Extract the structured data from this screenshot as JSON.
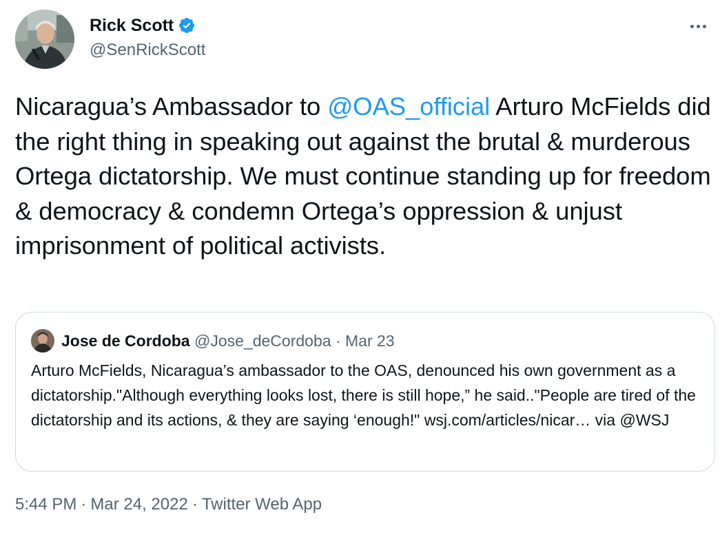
{
  "author": {
    "display_name": "Rick Scott",
    "handle": "@SenRickScott",
    "verified": true,
    "avatar_icon": "profile-photo"
  },
  "more_icon": "more-horizontal-icon",
  "tweet": {
    "text_part1": "Nicaragua’s Ambassador to ",
    "mention": "@OAS_official",
    "text_part2": " Arturo McFields did the right thing in speaking out against the brutal & murderous Ortega dictatorship. We must continue standing up for freedom & democracy & condemn Ortega’s oppression & unjust imprisonment of political activists."
  },
  "quoted_tweet": {
    "display_name": "Jose de Cordoba",
    "handle": "@Jose_deCordoba",
    "separator": "·",
    "date": "Mar 23",
    "text": "Arturo McFields, Nicaragua’s ambassador to the OAS, denounced his own government as a dictatorship.\"Although everything looks lost, there is still hope,” he said..\"People are tired of the dictatorship and its actions, & they are saying ‘enough!\" wsj.com/articles/nicar… via @WSJ"
  },
  "footer": {
    "time": "5:44 PM",
    "date": "Mar 24, 2022",
    "source": "Twitter Web App",
    "separator": "·"
  },
  "colors": {
    "link": "#1d9bf0",
    "secondary_text": "#536471",
    "primary_text": "#0f1419",
    "border": "#cfd9de",
    "verified_badge": "#1d9bf0"
  }
}
